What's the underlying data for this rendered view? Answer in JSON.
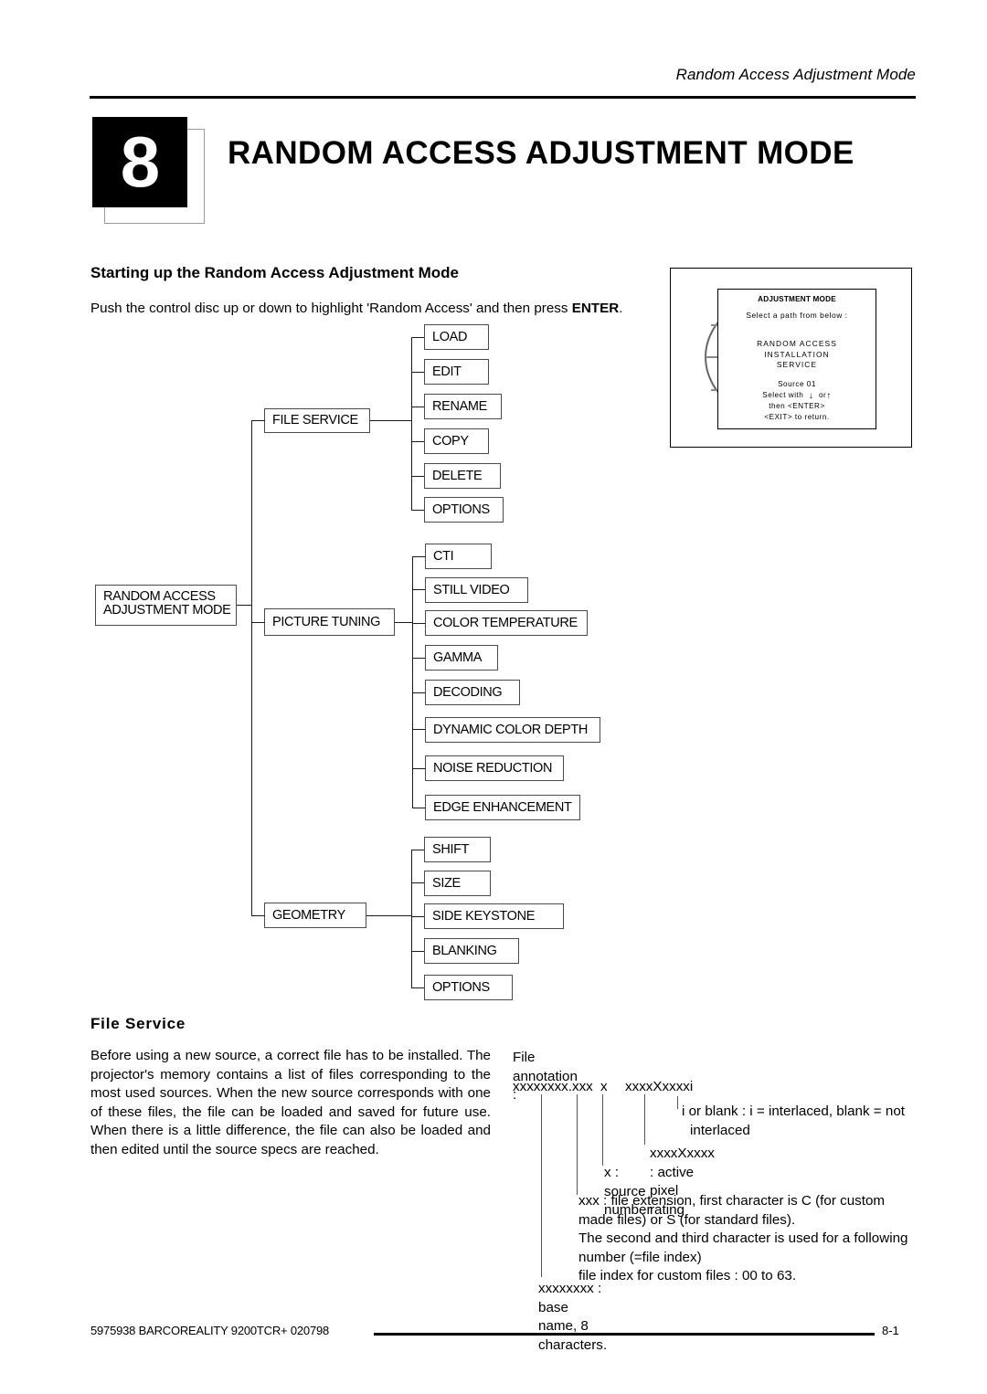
{
  "header": {
    "running_title": "Random Access Adjustment Mode"
  },
  "chapter": {
    "number": "8",
    "title": "RANDOM ACCESS ADJUSTMENT MODE"
  },
  "sections": {
    "starting_up": {
      "heading": "Starting up the Random Access Adjustment Mode",
      "intro_before": "Push the control disc up or down to highlight 'Random Access' and then press ",
      "intro_bold": "ENTER",
      "intro_after": "."
    },
    "file_service": {
      "heading": "File  Service",
      "body": "Before using a new source, a correct file has to be installed.  The projector's memory contains a list of files corresponding to the most used sources.  When the new source corresponds with one of these files, the file can be loaded and saved for future use.  When there is a little difference, the file can also be loaded and then edited until the source specs are reached."
    }
  },
  "osd": {
    "title": "ADJUSTMENT MODE",
    "subtitle": "Select a path from below :",
    "paths": [
      "RANDOM  ACCESS",
      "INSTALLATION",
      "SERVICE"
    ],
    "source_line": "Source  01",
    "select_prefix": "Select with",
    "down_arrow": "↓",
    "select_middle": "or",
    "up_arrow": "↑",
    "enter_line": "then  <ENTER>",
    "exit_line": "<EXIT>  to  return."
  },
  "tree": {
    "root": {
      "line1": "RANDOM ACCESS",
      "line2": "ADJUSTMENT MODE"
    },
    "branches": [
      {
        "label": "FILE SERVICE",
        "children": [
          "LOAD",
          "EDIT",
          "RENAME",
          "COPY",
          "DELETE",
          "OPTIONS"
        ]
      },
      {
        "label": "PICTURE TUNING",
        "children": [
          "CTI",
          "STILL VIDEO",
          "COLOR TEMPERATURE",
          "GAMMA",
          "DECODING",
          "DYNAMIC COLOR DEPTH",
          "NOISE REDUCTION",
          "EDGE ENHANCEMENT"
        ]
      },
      {
        "label": "GEOMETRY",
        "children": [
          "SHIFT",
          "SIZE",
          "SIDE KEYSTONE",
          "BLANKING",
          "OPTIONS"
        ]
      }
    ]
  },
  "annotation": {
    "heading": "File annotation :",
    "pattern_base": "xxxxxxxx.xxx",
    "pattern_source": "x",
    "pattern_pixel": "xxxxXxxxxi",
    "notes": {
      "interlace_line1": "i or blank : i = interlaced, blank = not",
      "interlace_line2": "interlaced",
      "pixel_rating": "xxxxXxxxx :  active  pixel  rating",
      "source_number": "x :  source number",
      "extension_block": "xxx : file extension, first character is C (for custom made files) or S (for standard files).\nThe second and third character is used for a following number (=file index)\nfile index for custom files :  00 to 63.",
      "base_name": "xxxxxxxx :  base  name,   8  characters."
    }
  },
  "footer": {
    "left": "5975938 BARCOREALITY 9200TCR+ 020798",
    "page": "8-1"
  }
}
